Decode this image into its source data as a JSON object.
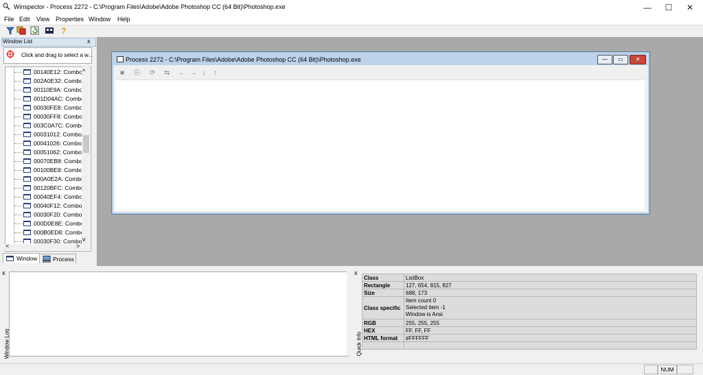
{
  "window": {
    "title": "Winspector - Process 2272 - C:\\Program Files\\Adobe\\Adobe Photoshop CC (64 Bit)\\Photoshop.exe",
    "minimize": "—",
    "maximize": "☐",
    "close": "✕"
  },
  "menu": [
    "File",
    "Edit",
    "View",
    "Properties",
    "Window",
    "Help"
  ],
  "window_list": {
    "title": "Window List",
    "close": "x",
    "click_drag": "Click and drag to select a w...",
    "items": [
      "00140E12: Combol",
      "002A0E32: Combo",
      "00110E9A: Combo",
      "001D04AC: Combo",
      "00030FE8: Combol",
      "00030FF8: Combol",
      "003C0A7C: Combo",
      "00031012: Combol",
      "00041026: Combol",
      "00051062: Combol",
      "00070EB8: Combol",
      "00100BE8: Combol",
      "000A0E2A: Combo",
      "00120BFC: Combol",
      "00040EF4: Combol",
      "00040F12: Combol",
      "00030F20: Combol",
      "000D0E8E: Combo",
      "000B0ED8: Combo",
      "00030F30: Combol"
    ],
    "scroll_up": "^",
    "scroll_down": "v",
    "scroll_left": "<",
    "scroll_right": ">",
    "tabs": {
      "window": "Window",
      "process": "Process"
    }
  },
  "child_window": {
    "title": "Process 2272 - C:\\Program Files\\Adobe\\Adobe Photoshop CC (64 Bit)\\Photoshop.exe",
    "min": "—",
    "restore": "▭",
    "close": "✕",
    "toolbar": [
      "■",
      "⎘",
      "⟳",
      "⇆",
      "←",
      "→",
      "↓",
      "↑"
    ]
  },
  "window_log": {
    "label": "Window Log",
    "close": "x"
  },
  "quick_info": {
    "label": "Quick Info",
    "close": "x",
    "rows": [
      {
        "key": "Class",
        "value": "ListBox"
      },
      {
        "key": "Rectangle",
        "value": "127, 654, 815, 827"
      },
      {
        "key": "Size",
        "value": "688, 173"
      },
      {
        "key": "Class specific",
        "value": [
          "Item count 0",
          "Selected item -1",
          "Window is Ansi"
        ]
      },
      {
        "key": "RGB",
        "value": "255, 255, 255"
      },
      {
        "key": "HEX",
        "value": "FF, FF, FF"
      },
      {
        "key": "HTML format",
        "value": "#FFFFFF"
      },
      {
        "key": "",
        "value": ""
      }
    ]
  },
  "status": {
    "num": "NUM"
  },
  "colors": {
    "mdi_background": "#a9a9a9",
    "close_red": "#c9463d",
    "child_title": "#bcd3ea"
  }
}
